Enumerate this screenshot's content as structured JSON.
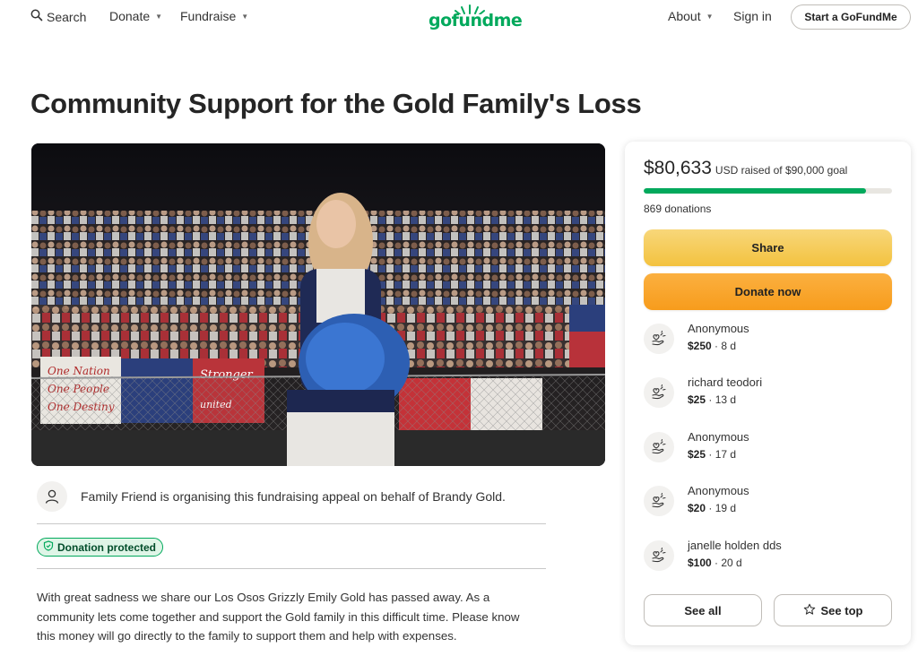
{
  "header": {
    "search_label": "Search",
    "donate_label": "Donate",
    "fundraise_label": "Fundraise",
    "logo_text": "gofundme",
    "about_label": "About",
    "signin_label": "Sign in",
    "start_label": "Start a GoFundMe"
  },
  "campaign": {
    "title": "Community Support for the Gold Family's Loss",
    "organizer_text": "Family Friend is organising this fundraising appeal on behalf of Brandy Gold.",
    "protected_label": "Donation protected",
    "story": "With great sadness we share our Los Osos Grizzly Emily Gold has passed away. As a community lets come together and support the Gold family in this difficult time. Please know this money will go directly to the family to support them and help with expenses."
  },
  "sidebar": {
    "amount_raised": "$80,633",
    "goal_text": "USD raised of $90,000 goal",
    "progress_fraction": 0.896,
    "donations_count": "869 donations",
    "share_label": "Share",
    "donate_label": "Donate now",
    "donors": [
      {
        "name": "Anonymous",
        "amount": "$250",
        "time": "8 d"
      },
      {
        "name": "richard teodori",
        "amount": "$25",
        "time": "13 d"
      },
      {
        "name": "Anonymous",
        "amount": "$25",
        "time": "17 d"
      },
      {
        "name": "Anonymous",
        "amount": "$20",
        "time": "19 d"
      },
      {
        "name": "janelle holden dds",
        "amount": "$100",
        "time": "20 d"
      }
    ],
    "see_all_label": "See all",
    "see_top_label": "See top"
  },
  "colors": {
    "brand_green": "#02a95c",
    "share_yellow": "#f3c23f",
    "donate_orange": "#f79c1c"
  },
  "icons": {
    "search": "search-icon",
    "organizer": "user-icon",
    "protected": "shield-icon",
    "donor": "heart-hand-icon",
    "see_top": "star-icon"
  }
}
